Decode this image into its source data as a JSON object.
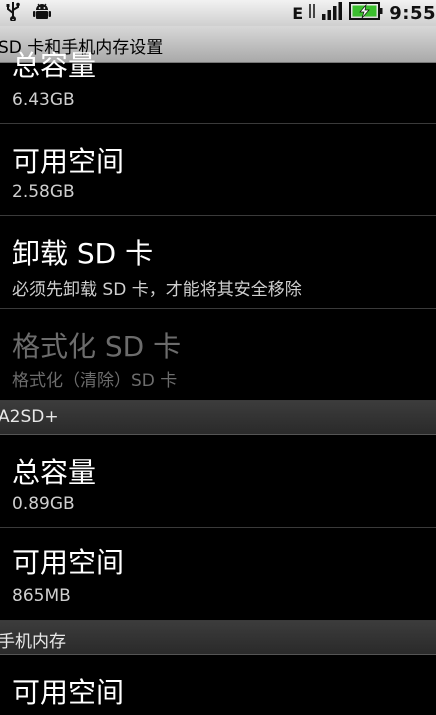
{
  "status_bar": {
    "time": "9:55",
    "network_type": "E",
    "icons": [
      "usb-icon",
      "android-debug-icon",
      "signal-icon",
      "battery-charging-icon"
    ]
  },
  "header": {
    "title": "SD 卡和手机内存设置"
  },
  "sections": {
    "sd": {
      "total": {
        "title": "总容量",
        "value": "6.43GB"
      },
      "available": {
        "title": "可用空间",
        "value": "2.58GB"
      },
      "unmount": {
        "title": "卸载 SD 卡",
        "summary": "必须先卸载 SD 卡，才能将其安全移除"
      },
      "format": {
        "title": "格式化 SD 卡",
        "summary": "格式化（清除）SD 卡"
      }
    },
    "a2sd": {
      "header": "A2SD+",
      "total": {
        "title": "总容量",
        "value": "0.89GB"
      },
      "available": {
        "title": "可用空间",
        "value": "865MB"
      }
    },
    "phone": {
      "header": "手机内存",
      "available": {
        "title": "可用空间"
      }
    }
  }
}
